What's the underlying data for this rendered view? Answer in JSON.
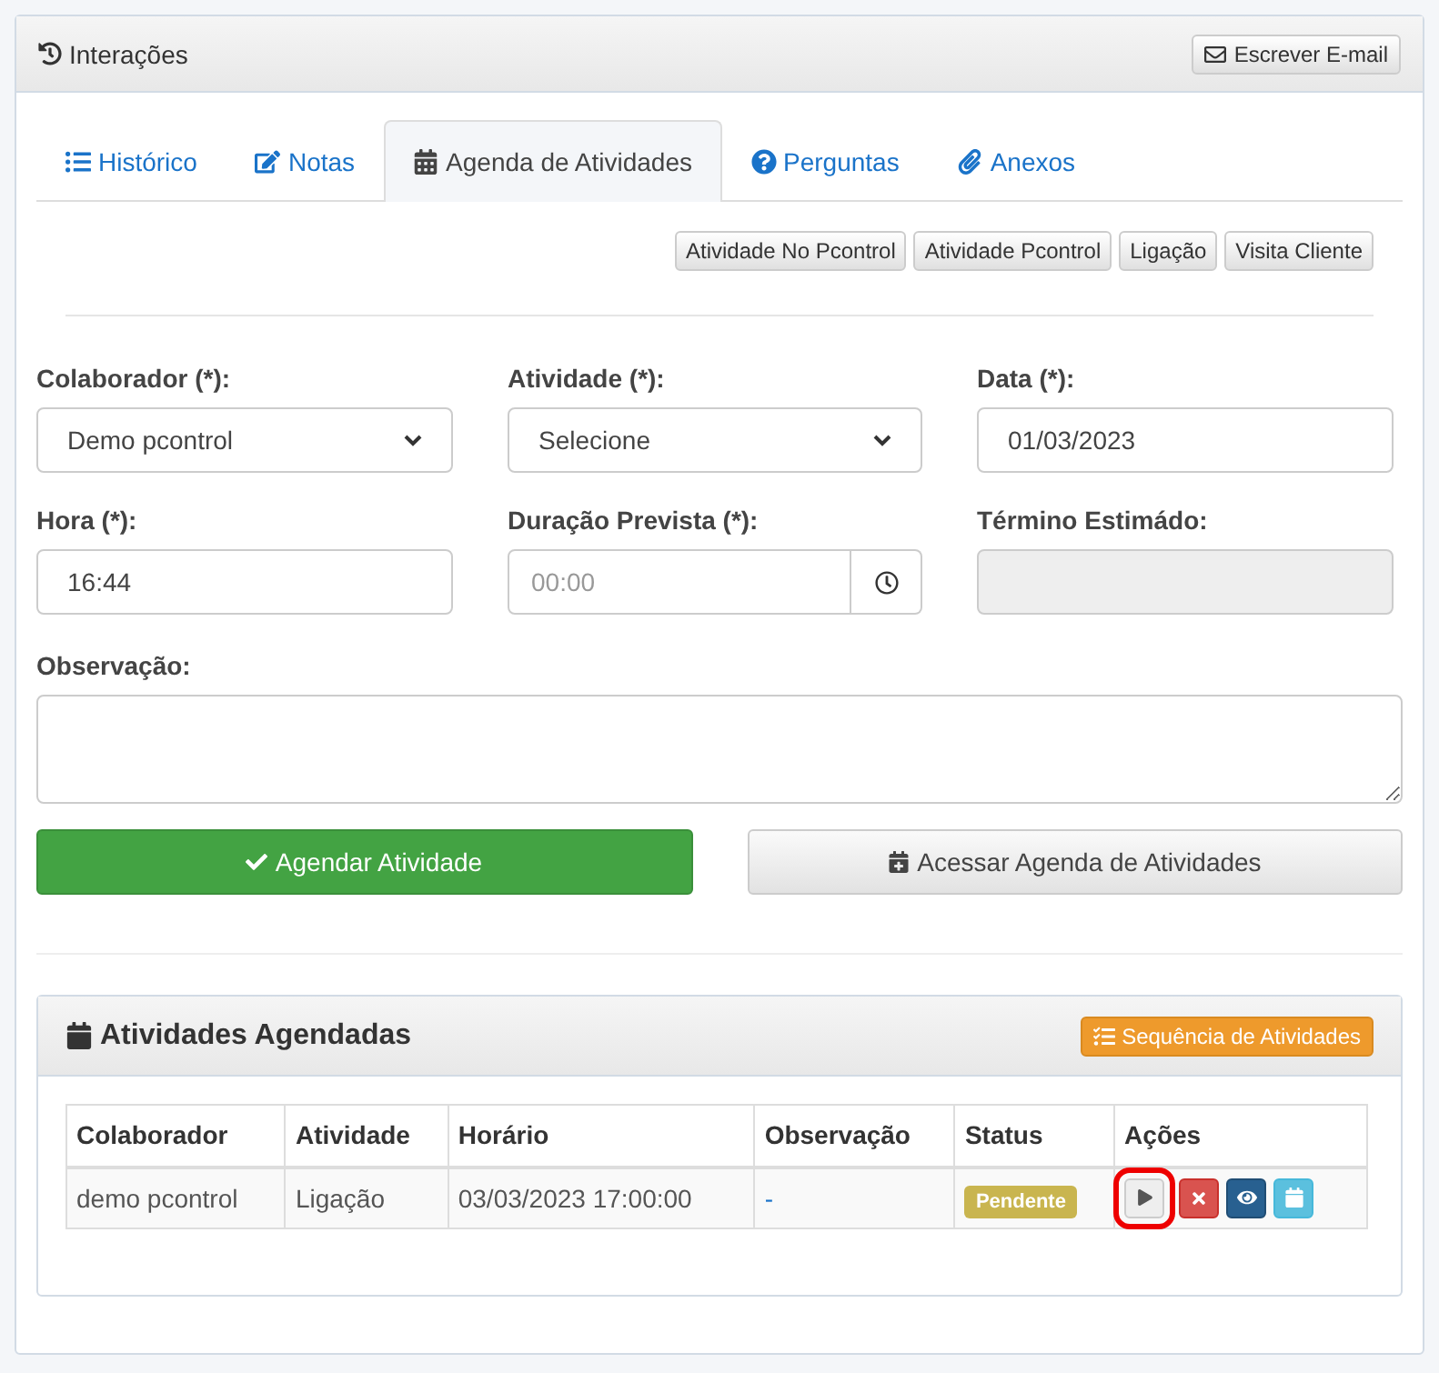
{
  "panel": {
    "title": "Interações",
    "email_button": "Escrever E-mail"
  },
  "tabs": [
    {
      "label": "Histórico",
      "kind": "history",
      "selected": false
    },
    {
      "label": "Notas",
      "kind": "notes",
      "selected": false
    },
    {
      "label": "Agenda de Atividades",
      "kind": "agenda",
      "selected": true
    },
    {
      "label": "Perguntas",
      "kind": "questions",
      "selected": false
    },
    {
      "label": "Anexos",
      "kind": "attachments",
      "selected": false
    }
  ],
  "quick_buttons": [
    "Atividade No Pcontrol",
    "Atividade Pcontrol",
    "Ligação",
    "Visita Cliente"
  ],
  "fields": [
    {
      "label": "Colaborador (*):",
      "kind": "select",
      "value": "Demo pcontrol"
    },
    {
      "label": "Atividade (*):",
      "kind": "select",
      "value": "Selecione"
    },
    {
      "label": "Data (*):",
      "kind": "text",
      "value": "01/03/2023"
    },
    {
      "label": "Hora (*):",
      "kind": "text",
      "value": "16:44"
    },
    {
      "label": "Duração Prevista (*):",
      "kind": "time",
      "placeholder": "00:00"
    },
    {
      "label": "Término Estimádo:",
      "kind": "disabled"
    }
  ],
  "observation": {
    "label": "Observação:"
  },
  "schedule_button": "Agendar Atividade",
  "agenda_button": "Acessar Agenda de Atividades",
  "scheduled": {
    "title": "Atividades Agendadas",
    "sequence_button": "Sequência de Atividades",
    "columns": [
      "Colaborador",
      "Atividade",
      "Horário",
      "Observação",
      "Status",
      "Ações"
    ],
    "rows": [
      {
        "colaborador": "demo pcontrol",
        "atividade": "Ligação",
        "horario": "03/03/2023 17:00:00",
        "observacao": "-",
        "status": "Pendente",
        "actions": [
          {
            "kind": "play",
            "highlighted": true
          },
          {
            "kind": "delete",
            "highlighted": false
          },
          {
            "kind": "view",
            "highlighted": false
          },
          {
            "kind": "calendar",
            "highlighted": false
          }
        ]
      }
    ]
  }
}
